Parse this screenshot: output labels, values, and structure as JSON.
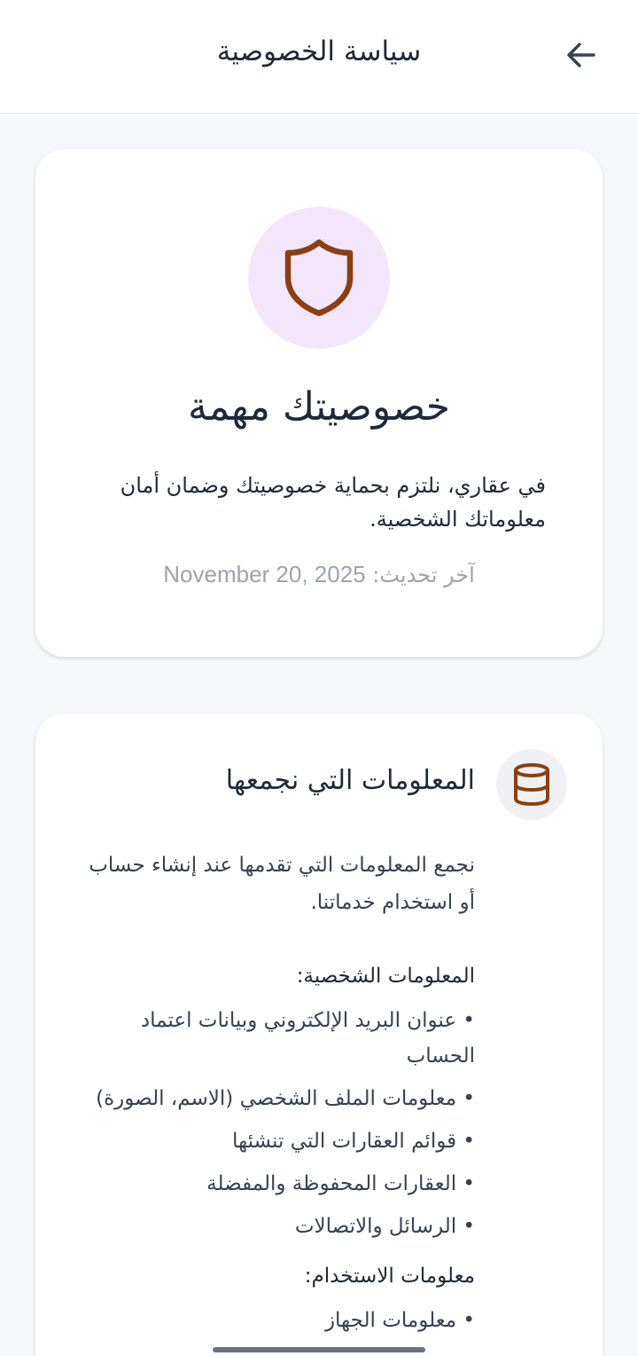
{
  "app_bar": {
    "title": "سياسة الخصوصية",
    "back_icon": "arrow-left-icon"
  },
  "hero": {
    "icon": "shield-icon",
    "title": "خصوصيتك مهمة",
    "description": "في عقاري، نلتزم بحماية خصوصيتك وضمان أمان معلوماتك الشخصية.",
    "last_updated_label": "آخر تحديث:",
    "last_updated_date": "November 20, 2025"
  },
  "sections": [
    {
      "icon": "database-icon",
      "title": "المعلومات التي نجمعها",
      "intro": "نجمع المعلومات التي تقدمها عند إنشاء حساب أو استخدام خدماتنا.",
      "personal_heading": "المعلومات الشخصية:",
      "personal_items": [
        "عنوان البريد الإلكتروني وبيانات اعتماد الحساب",
        "معلومات الملف الشخصي (الاسم، الصورة)",
        "قوائم العقارات التي تنشئها",
        "العقارات المحفوظة والمفضلة",
        "الرسائل والاتصالات"
      ],
      "usage_heading": "معلومات الاستخدام:",
      "usage_items": [
        "معلومات الجهاز"
      ]
    }
  ],
  "colors": {
    "accent_brown": "#8b3f12",
    "shield_bg": "#f3e6fb",
    "page_bg": "#f6f7f9"
  }
}
